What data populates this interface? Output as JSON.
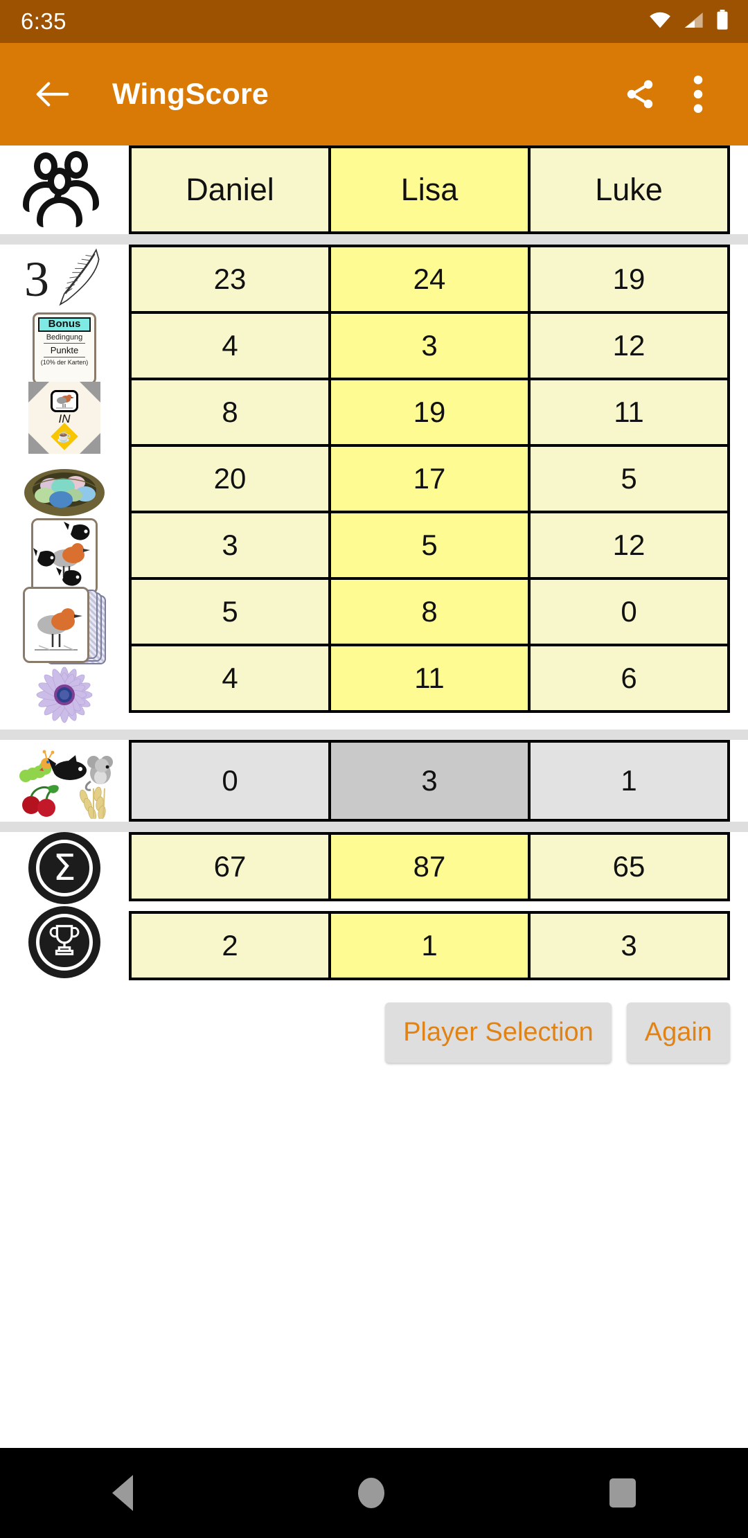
{
  "status_bar": {
    "time": "6:35",
    "icons": [
      "wifi-icon",
      "cellular-signal-icon",
      "battery-icon"
    ],
    "background_color": "#9C5200"
  },
  "app_bar": {
    "title": "WingScore",
    "back_label": "Back",
    "share_label": "Share",
    "overflow_label": "More options",
    "background_color": "#D97A07"
  },
  "colors": {
    "cell_normal": "#F7F7CB",
    "cell_highlight": "#FDFB92",
    "cell_gray": "#E2E2E2",
    "cell_gray_highlight": "#C9C9C9",
    "accent": "#E08214",
    "separator": "#DEDEDE"
  },
  "scoreboard": {
    "header": {
      "row_icon": "players-icon",
      "players": [
        "Daniel",
        "Lisa",
        "Luke"
      ],
      "highlighted_player_index": 1
    },
    "rows": [
      {
        "icon": "bird-points-feather-icon",
        "values": [
          "23",
          "24",
          "19"
        ]
      },
      {
        "icon": "bonus-card-icon",
        "values": [
          "4",
          "3",
          "12"
        ]
      },
      {
        "icon": "end-of-round-goal-icon",
        "values": [
          "8",
          "19",
          "11"
        ]
      },
      {
        "icon": "eggs-nest-icon",
        "values": [
          "20",
          "17",
          "5"
        ]
      },
      {
        "icon": "cached-food-icon",
        "values": [
          "3",
          "5",
          "12"
        ]
      },
      {
        "icon": "tucked-cards-icon",
        "values": [
          "5",
          "8",
          "0"
        ]
      },
      {
        "icon": "nectar-flower-icon",
        "values": [
          "4",
          "11",
          "6"
        ]
      }
    ],
    "food_row": {
      "icon": "food-tokens-icon",
      "values": [
        "0",
        "3",
        "1"
      ]
    },
    "sum_row": {
      "icon": "sum-sigma-coin-icon",
      "values": [
        "67",
        "87",
        "65"
      ],
      "glyph": "Σ"
    },
    "rank_row": {
      "icon": "trophy-coin-icon",
      "values": [
        "2",
        "1",
        "3"
      ],
      "glyph": "🏆"
    },
    "bonus_card_labels": {
      "title": "Bonus",
      "condition": "Bedingung",
      "points": "Punkte",
      "note": "(10% der Karten)"
    },
    "goal_tile_label": "IN",
    "feather_digit": "3"
  },
  "buttons": {
    "player_selection": "Player Selection",
    "again": "Again"
  },
  "nav_bar": {
    "back": "back-triangle-icon",
    "home": "home-circle-icon",
    "recents": "recents-square-icon"
  }
}
